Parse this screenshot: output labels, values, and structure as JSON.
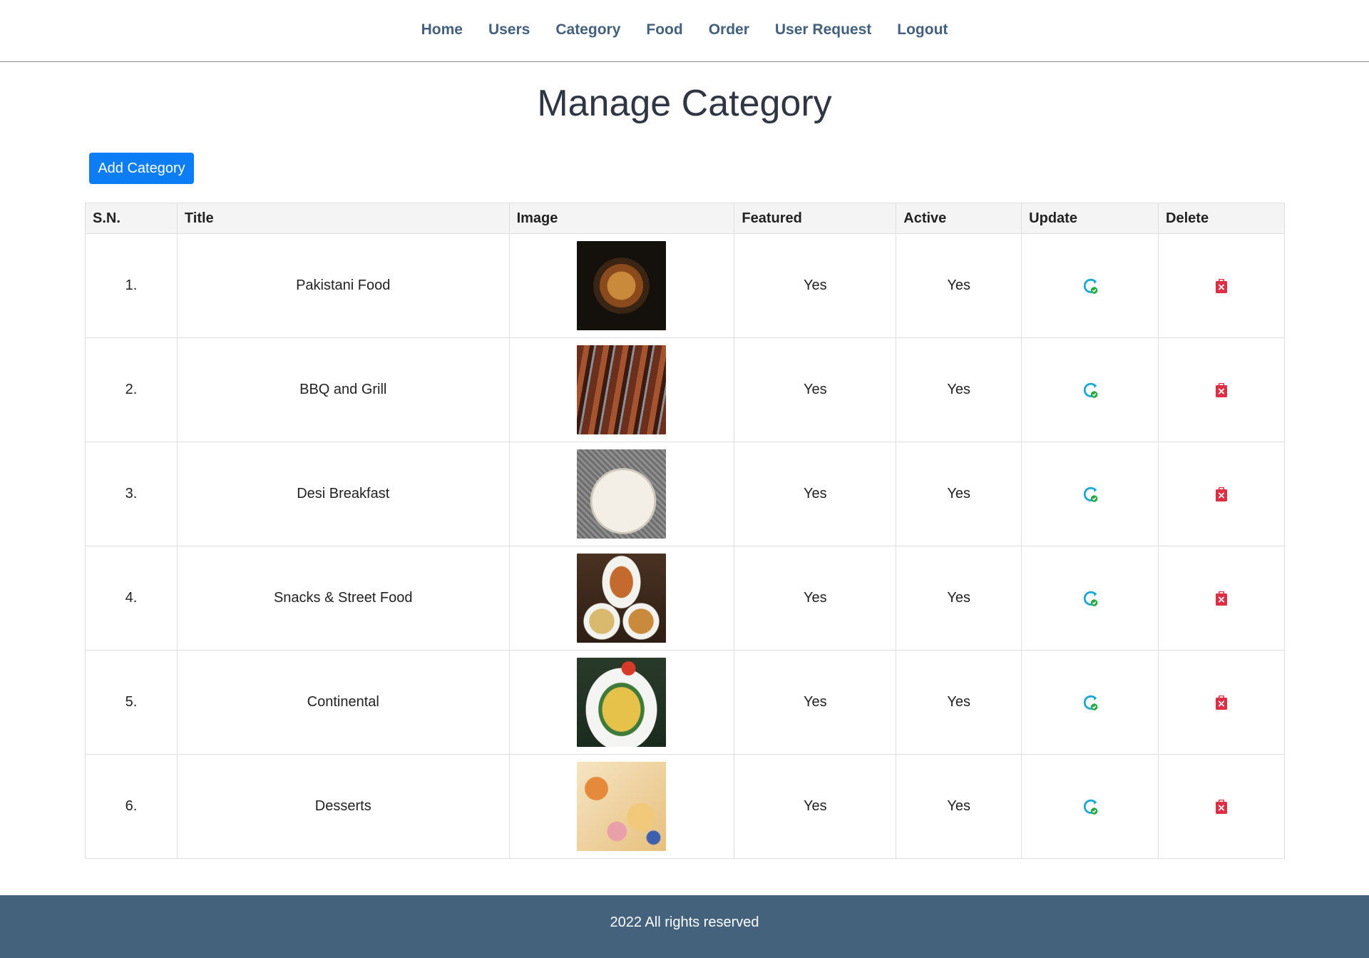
{
  "nav": {
    "items": [
      "Home",
      "Users",
      "Category",
      "Food",
      "Order",
      "User Request",
      "Logout"
    ]
  },
  "page": {
    "title": "Manage Category",
    "add_button": "Add Category"
  },
  "table": {
    "headers": [
      "S.N.",
      "Title",
      "Image",
      "Featured",
      "Active",
      "Update",
      "Delete"
    ],
    "rows": [
      {
        "sn": "1.",
        "title": "Pakistani Food",
        "featured": "Yes",
        "active": "Yes",
        "image_icon": "thali-platter-photo"
      },
      {
        "sn": "2.",
        "title": "BBQ and Grill",
        "featured": "Yes",
        "active": "Yes",
        "image_icon": "bbq-skewers-photo"
      },
      {
        "sn": "3.",
        "title": "Desi Breakfast",
        "featured": "Yes",
        "active": "Yes",
        "image_icon": "paratha-breakfast-photo"
      },
      {
        "sn": "4.",
        "title": "Snacks & Street Food",
        "featured": "Yes",
        "active": "Yes",
        "image_icon": "samosa-chaat-photo"
      },
      {
        "sn": "5.",
        "title": "Continental",
        "featured": "Yes",
        "active": "Yes",
        "image_icon": "continental-plate-photo"
      },
      {
        "sn": "6.",
        "title": "Desserts",
        "featured": "Yes",
        "active": "Yes",
        "image_icon": "desserts-platter-photo"
      }
    ]
  },
  "footer": {
    "text": "2022 All rights reserved"
  },
  "colors": {
    "nav_text": "#44607c",
    "primary_button": "#0d7df5",
    "footer_bg": "#45627d",
    "update_icon": "#1ba8d6",
    "update_check": "#28a745",
    "delete_icon": "#dc2f45"
  }
}
